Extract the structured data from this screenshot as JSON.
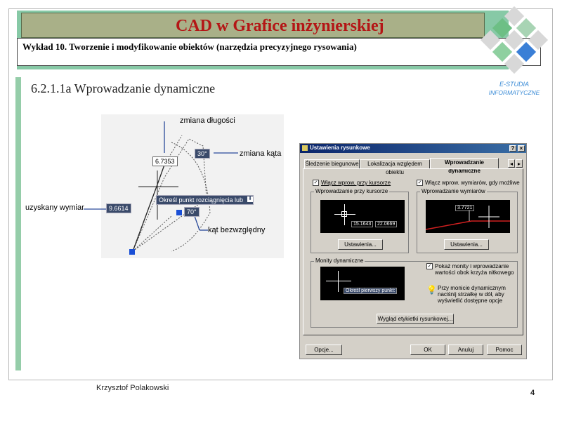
{
  "header": {
    "title": "CAD w Grafice inżynierskiej",
    "lecture": "Wykład 10. Tworzenie i modyfikowanie obiektów (narzędzia precyzyjnego rysowania)"
  },
  "logo": {
    "line1": "E-STUDIA",
    "line2": "INFORMATYCZNE"
  },
  "section": {
    "title": "6.2.1.1a Wprowadzanie dynamiczne"
  },
  "cad_illustration": {
    "label_length": "zmiana długości",
    "label_angle": "zmiana kąta",
    "label_dimension": "uzyskany wymiar",
    "label_abs_angle": "kąt bezwzględny",
    "value_length": "6.7353",
    "value_angle": "30°",
    "value_dimension": "9.6614",
    "value_abs_angle": "70°",
    "prompt": "Określ punkt rozciągnięcia lub"
  },
  "dialog": {
    "title": "Ustawienia rysunkowe",
    "tabs": [
      "Śledzenie biegunowe",
      "Lokalizacja względem obiektu",
      "Wprowadzanie dynamiczne"
    ],
    "chk_pointer": "Włącz wprow. przy kursorze",
    "chk_dimension": "Włącz wprow. wymiarów, gdy możliwe",
    "grp_pointer": "Wprowadzanie przy kursorze",
    "grp_dimension": "Wprowadzanie wymiarów",
    "pointer_x": "15.1643",
    "pointer_y": "22.0669",
    "dim_value": "3.7721",
    "btn_settings": "Ustawienia...",
    "grp_prompts": "Monity dynamiczne",
    "prompt_sample": "Określ pierwszy punkt:",
    "chk_prompts": "Pokaż monity i wprowadzanie wartości obok krzyża nitkowego",
    "info_text": "Przy monicie dynamicznym naciśnij strzałkę w dół, aby wyświetlić dostępne opcje",
    "btn_appearance": "Wygląd etykietki rysunkowej...",
    "btn_options": "Opcje...",
    "btn_ok": "OK",
    "btn_cancel": "Anuluj",
    "btn_help": "Pomoc"
  },
  "footer": {
    "author": "Krzysztof Polakowski",
    "page": "4"
  },
  "colors": {
    "title_red": "#b41616",
    "header_green": "#87c9a6",
    "title_box": "#a9b088"
  }
}
